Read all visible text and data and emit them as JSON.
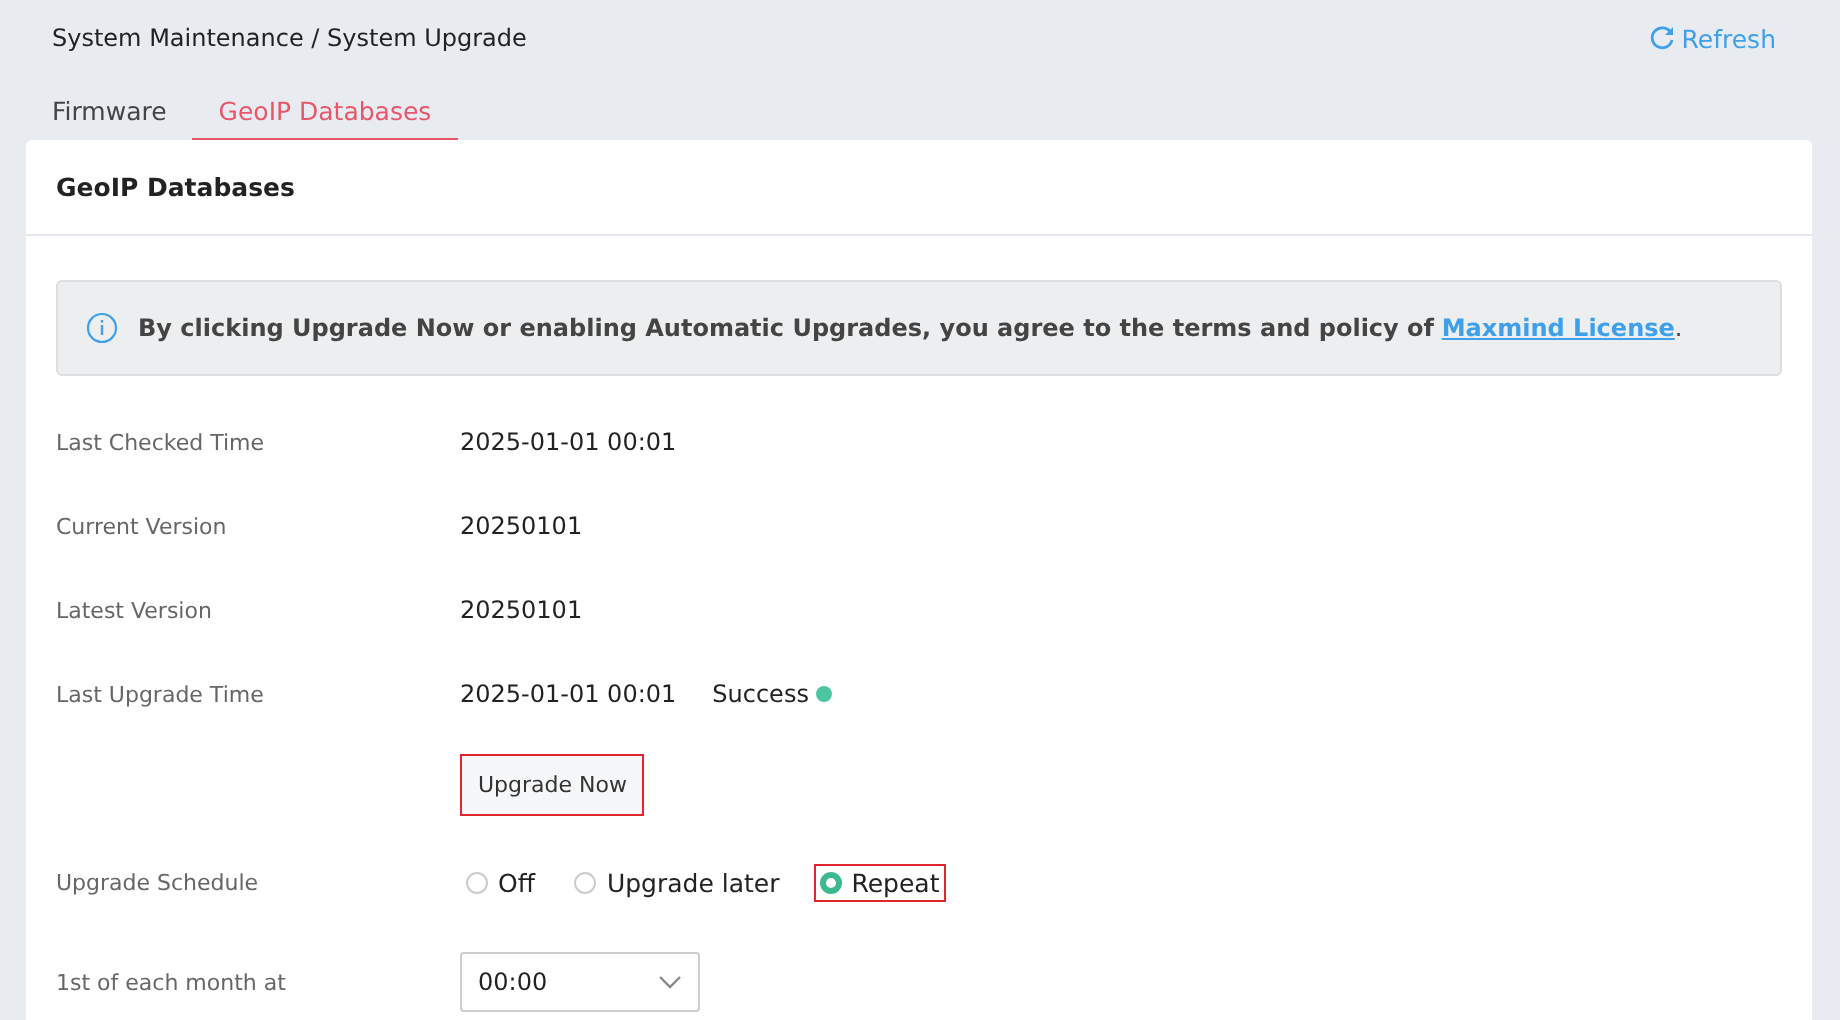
{
  "breadcrumb": "System Maintenance / System Upgrade",
  "refresh": {
    "label": "Refresh"
  },
  "tabs": [
    {
      "label": "Firmware",
      "selected": false
    },
    {
      "label": "GeoIP Databases",
      "selected": true
    }
  ],
  "card": {
    "title": "GeoIP Databases",
    "notice": {
      "text": "**By clicking Upgrade Now or enabling Automatic Upgrades, you agree to the terms and policy of** ",
      "link": "Maxmind License",
      "after": "."
    },
    "fields": [
      {
        "label": "Last Checked Time",
        "value": "2025-01-01 00:01"
      },
      {
        "label": "Current Version",
        "value": "20250101"
      },
      {
        "label": "Latest Version",
        "value": "20250101"
      },
      {
        "label": "Last Upgrade Time",
        "value": "2025-01-01 00:01",
        "status": "Success",
        "color": "#4cc6a1"
      }
    ],
    "upgrade_button": {
      "label": "Upgrade Now",
      "highlighted": true
    },
    "schedule": {
      "label": "Upgrade Schedule",
      "options": [
        {
          "label": "Off",
          "selected": false,
          "highlighted": false
        },
        {
          "label": "Upgrade later",
          "selected": false,
          "highlighted": false
        },
        {
          "label": "Repeat",
          "selected": true,
          "highlighted": true
        }
      ]
    },
    "time": {
      "label": "1st of each month at",
      "value": "00:00"
    }
  }
}
